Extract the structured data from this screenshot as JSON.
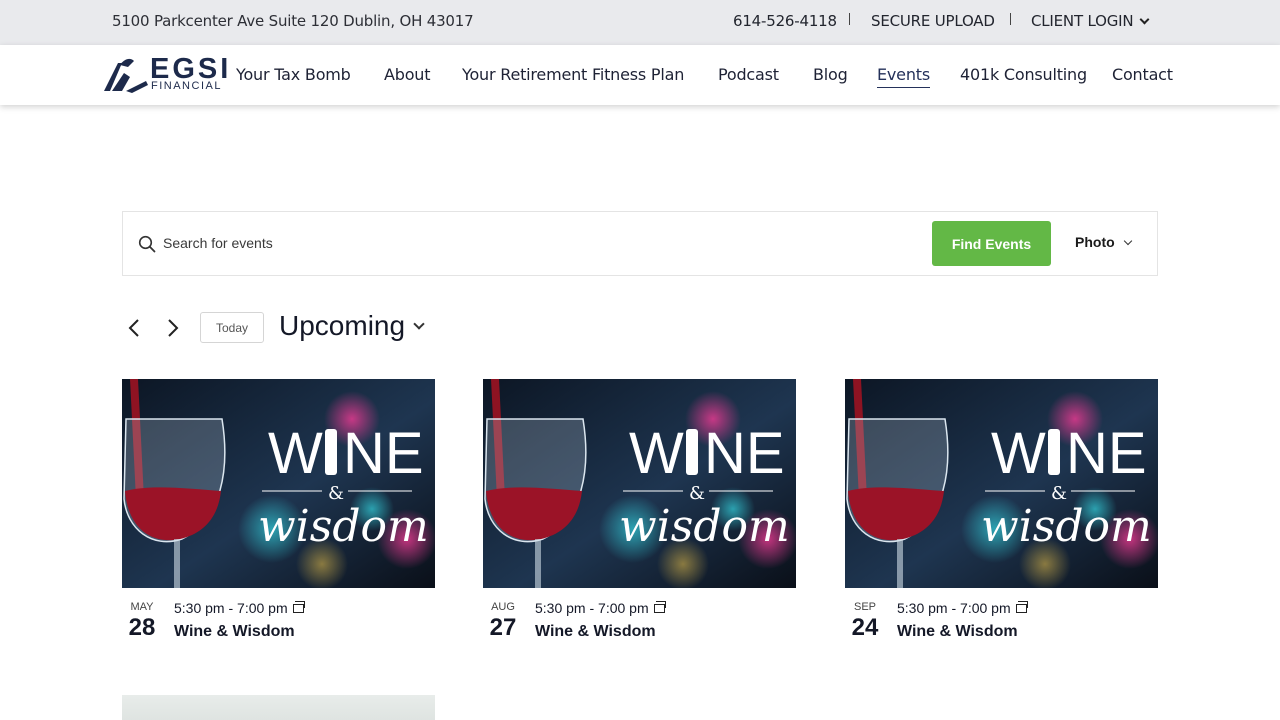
{
  "topbar": {
    "address": "5100 Parkcenter Ave Suite 120 Dublin, OH 43017",
    "phone": "614-526-4118",
    "secure_upload": "SECURE UPLOAD",
    "client_login": "CLIENT LOGIN"
  },
  "logo": {
    "word": "EGSI",
    "sub": "FINANCIAL"
  },
  "nav": {
    "items": [
      {
        "label": "Your Tax Bomb"
      },
      {
        "label": "About"
      },
      {
        "label": "Your Retirement Fitness Plan"
      },
      {
        "label": "Podcast"
      },
      {
        "label": "Blog"
      },
      {
        "label": "Events"
      },
      {
        "label": "401k Consulting"
      },
      {
        "label": "Contact"
      }
    ],
    "active": "Events"
  },
  "search": {
    "placeholder": "Search for events",
    "button_label": "Find Events",
    "view_label": "Photo"
  },
  "datenav": {
    "today_label": "Today",
    "range_label": "Upcoming"
  },
  "events": [
    {
      "month": "MAY",
      "day": "28",
      "time": "5:30 pm - 7:00 pm",
      "title": "Wine & Wisdom",
      "image_word_top": "W",
      "image_word_top2": "NE",
      "image_amp": "&",
      "image_word_bottom": "wisdom"
    },
    {
      "month": "AUG",
      "day": "27",
      "time": "5:30 pm - 7:00 pm",
      "title": "Wine & Wisdom",
      "image_word_top": "W",
      "image_word_top2": "NE",
      "image_amp": "&",
      "image_word_bottom": "wisdom"
    },
    {
      "month": "SEP",
      "day": "24",
      "time": "5:30 pm - 7:00 pm",
      "title": "Wine & Wisdom",
      "image_word_top": "W",
      "image_word_top2": "NE",
      "image_amp": "&",
      "image_word_bottom": "wisdom"
    }
  ],
  "colors": {
    "accent_green": "#63b846",
    "brand_navy": "#1d2a4b",
    "topbar_bg": "#e9eaed"
  }
}
